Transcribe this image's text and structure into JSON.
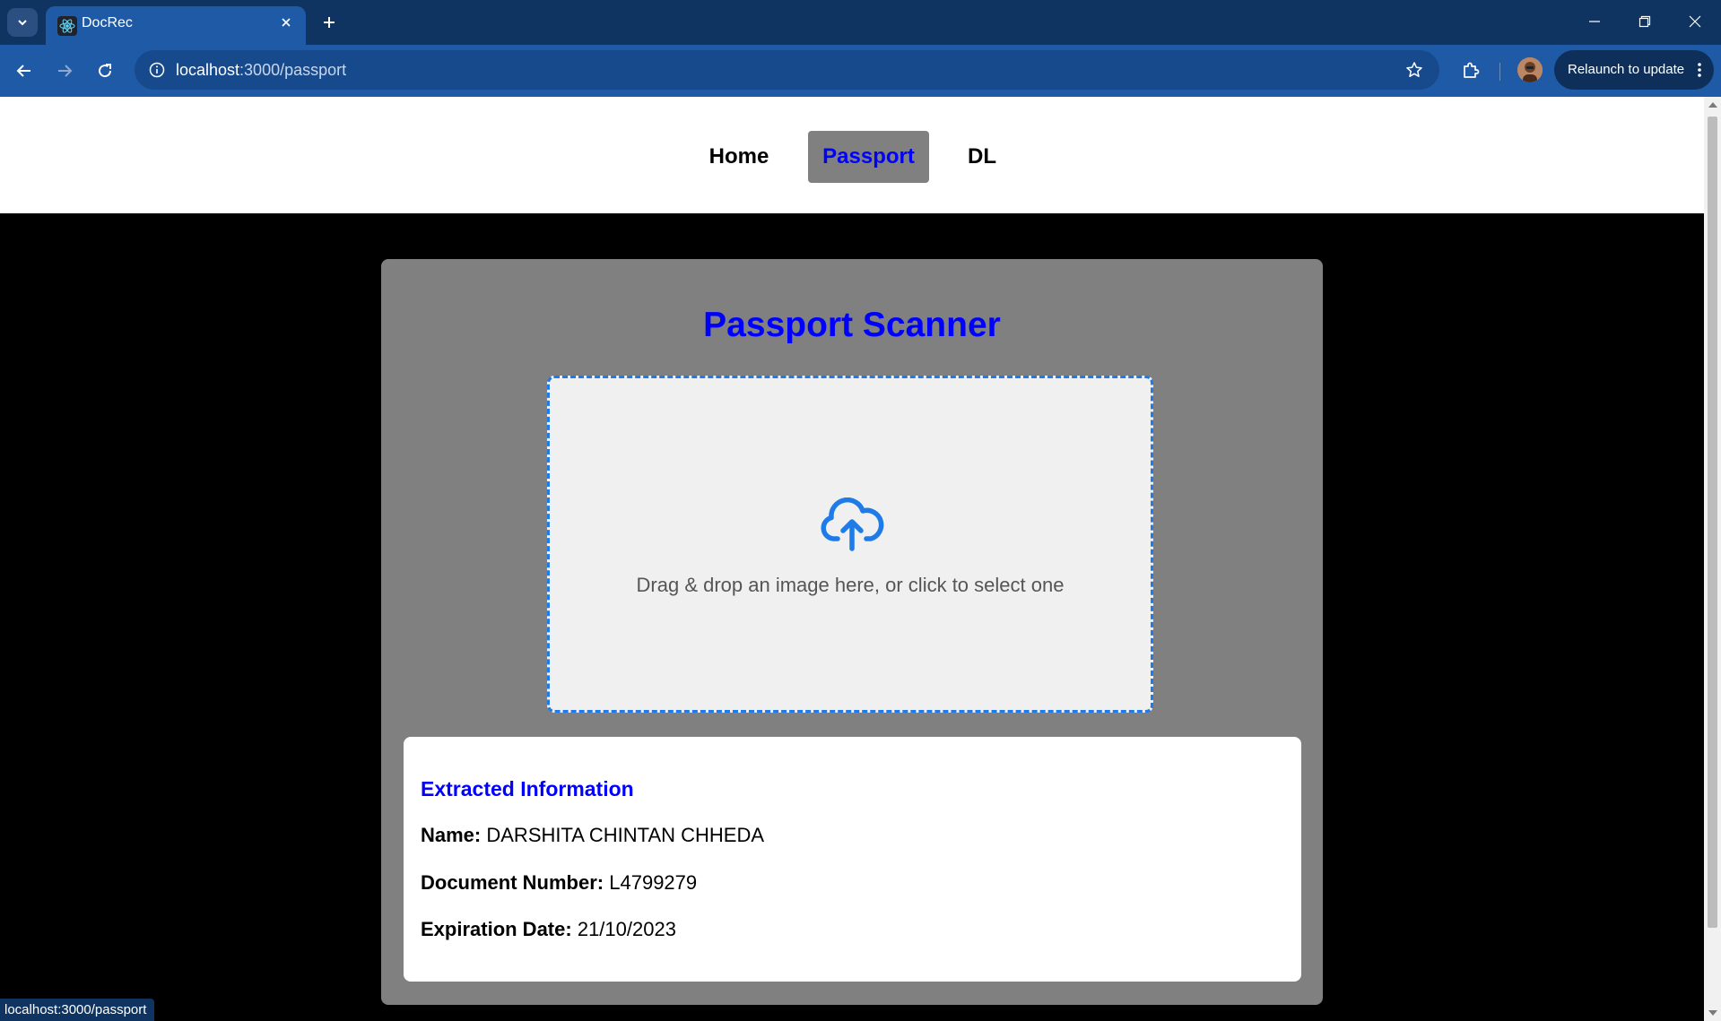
{
  "browser": {
    "tab_title": "DocRec",
    "url_host": "localhost",
    "url_path": ":3000/passport",
    "relaunch_label": "Relaunch to update",
    "status_url": "localhost:3000/passport"
  },
  "nav": {
    "items": [
      {
        "label": "Home",
        "active": false
      },
      {
        "label": "Passport",
        "active": true
      },
      {
        "label": "DL",
        "active": false
      }
    ]
  },
  "scanner": {
    "title": "Passport Scanner",
    "dropzone_text": "Drag & drop an image here, or click to select one",
    "upload_icon": "cloud-upload-icon"
  },
  "extracted": {
    "heading": "Extracted Information",
    "fields": [
      {
        "label": "Name:",
        "value": "DARSHITA CHINTAN CHHEDA"
      },
      {
        "label": "Document Number:",
        "value": "L4799279"
      },
      {
        "label": "Expiration Date:",
        "value": "21/10/2023"
      }
    ]
  },
  "colors": {
    "accent_blue": "#0000ff",
    "dropzone_border": "#1e7be8",
    "card_bg": "#808080",
    "chrome_blue": "#1f5aa6"
  }
}
